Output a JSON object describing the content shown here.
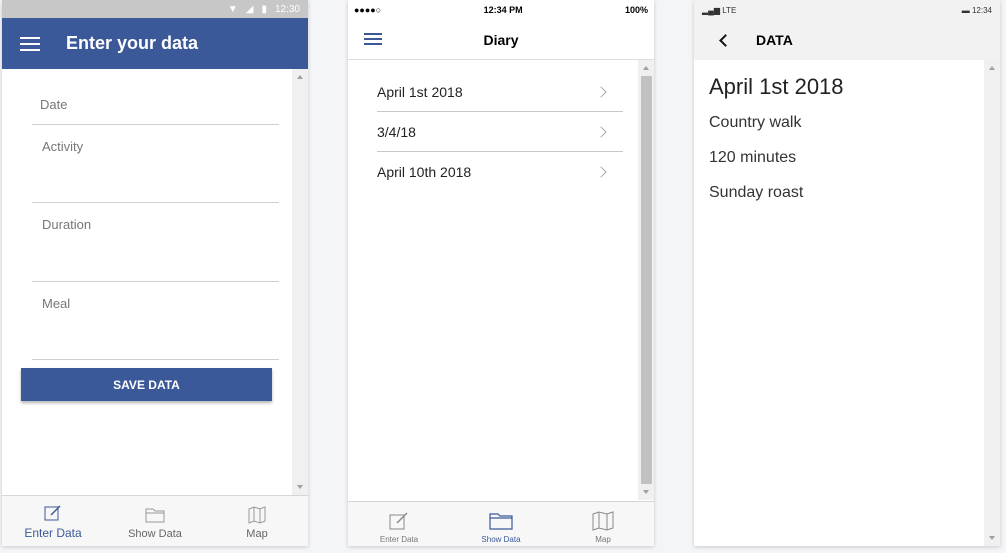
{
  "android": {
    "status": {
      "time": "12:30"
    },
    "appbar": {
      "title": "Enter your data"
    },
    "fields": [
      {
        "placeholder": "Date"
      },
      {
        "placeholder": "Activity"
      },
      {
        "placeholder": "Duration"
      },
      {
        "placeholder": "Meal"
      }
    ],
    "save_label": "SAVE DATA",
    "tabs": [
      {
        "label": "Enter Data",
        "icon": "edit-icon",
        "active": true
      },
      {
        "label": "Show Data",
        "icon": "folder-icon",
        "active": false
      },
      {
        "label": "Map",
        "icon": "map-icon",
        "active": false
      }
    ]
  },
  "ios": {
    "status": {
      "signal": "●●●●○",
      "time": "12:34 PM",
      "battery": "100%"
    },
    "nav": {
      "title": "Diary"
    },
    "entries": [
      {
        "label": "April 1st 2018"
      },
      {
        "label": "3/4/18"
      },
      {
        "label": "April 10th 2018"
      }
    ],
    "tabs": [
      {
        "label": "Enter Data",
        "icon": "edit-icon",
        "active": false
      },
      {
        "label": "Show Data",
        "icon": "folder-icon",
        "active": true
      },
      {
        "label": "Map",
        "icon": "map-icon",
        "active": false
      }
    ]
  },
  "windows": {
    "status": {
      "network": "LTE",
      "time": "12:34"
    },
    "header": {
      "title": "DATA"
    },
    "detail": {
      "date": "April 1st 2018",
      "activity": "Country walk",
      "duration": "120 minutes",
      "meal": "Sunday roast"
    }
  },
  "colors": {
    "accent": "#3b5998"
  }
}
